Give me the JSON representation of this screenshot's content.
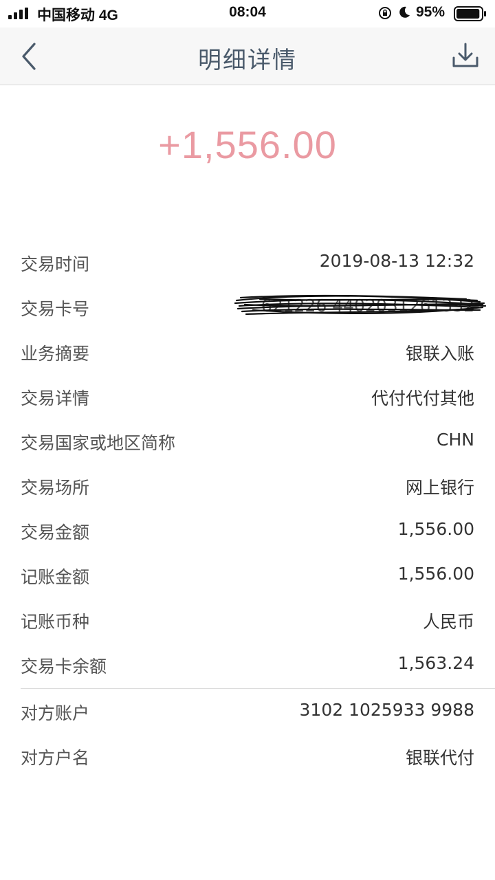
{
  "status_bar": {
    "carrier": "中国移动 4G",
    "time": "08:04",
    "battery_percent": "95%",
    "battery_level": 0.95
  },
  "nav": {
    "title": "明细详情",
    "back_icon": "chevron-left-icon",
    "download_icon": "download-icon"
  },
  "amount": "+1,556.00",
  "colors": {
    "amount": "#ea9aa2",
    "title": "#4a5a6b",
    "nav_bg": "#f7f7f7"
  },
  "details": [
    {
      "label": "交易时间",
      "value": "2019-08-13 12:32"
    },
    {
      "label": "交易卡号",
      "value": "621226 4402031261332"
    },
    {
      "label": "业务摘要",
      "value": "银联入账"
    },
    {
      "label": "交易详情",
      "value": "代付代付其他"
    },
    {
      "label": "交易国家或地区简称",
      "value": "CHN"
    },
    {
      "label": "交易场所",
      "value": "网上银行"
    },
    {
      "label": "交易金额",
      "value": "1,556.00"
    },
    {
      "label": "记账金额",
      "value": "1,556.00"
    },
    {
      "label": "记账币种",
      "value": "人民币"
    },
    {
      "label": "交易卡余额",
      "value": "1,563.24"
    }
  ],
  "counterparty": [
    {
      "label": "对方账户",
      "value": "3102 1025933 9988"
    },
    {
      "label": "对方户名",
      "value": "银联代付"
    }
  ]
}
